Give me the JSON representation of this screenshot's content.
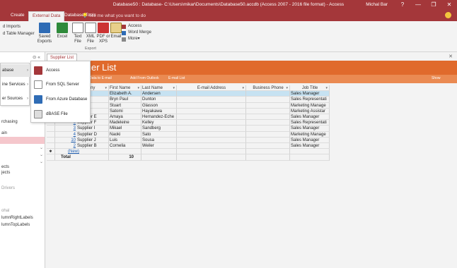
{
  "window": {
    "title": "Database50 : Database- C:\\Users\\mikar\\Documents\\Database50.accdb (Access 2007 - 2016 file format) - Access",
    "user": "Michal Bar",
    "controls": [
      "?",
      "—",
      "❐",
      "✕"
    ]
  },
  "ribbon_tabs": [
    "Create",
    "External Data",
    "Database Tools"
  ],
  "tell_me": "Tell me what you want to do",
  "ribbon": {
    "left_partial": [
      "d Imports",
      "d Table Manager"
    ],
    "buttons": [
      {
        "label": "Saved Exports",
        "icon": "saved-exports-icon"
      },
      {
        "label": "Excel",
        "icon": "excel-icon"
      },
      {
        "label": "Text File",
        "icon": "text-file-icon"
      },
      {
        "label": "XML File",
        "icon": "xml-file-icon"
      },
      {
        "label": "PDF or XPS",
        "icon": "pdf-icon"
      },
      {
        "label": "Email",
        "icon": "email-icon"
      }
    ],
    "small": [
      "Access",
      "Word Merge",
      "More"
    ],
    "group_label": "Export"
  },
  "nav": {
    "items": [
      "rchasing",
      "ain",
      "ects",
      "jects",
      "Drivers",
      "ohal",
      "lumnRightLabels",
      "lumnTopLabels"
    ]
  },
  "menu_left": [
    {
      "label": "abase",
      "arrow": "›"
    },
    {
      "label": "ine Services",
      "arrow": "›"
    },
    {
      "label": "er Sources",
      "arrow": "›"
    }
  ],
  "menu_right": [
    {
      "label": "Access",
      "icon": "access-icon"
    },
    {
      "label": "From SQL Server",
      "icon": "sql-server-icon"
    },
    {
      "label": "From Azure Database",
      "icon": "azure-database-icon"
    },
    {
      "label": "dBASE File",
      "icon": "dbase-icon"
    }
  ],
  "document": {
    "tab": "Supplier List",
    "banner_title": "plier List",
    "toolbar": [
      "ect Data to E-mail",
      "Add From Outlook",
      "E-mail List",
      "Show"
    ]
  },
  "grid": {
    "headers": [
      "ny",
      "First Name",
      "Last Name",
      "E-mail Address",
      "Business Phone",
      "Job Title"
    ],
    "rows": [
      {
        "num": "",
        "company": "",
        "first": "Elizabeth A.",
        "last": "Andersen",
        "title": "Sales Manager",
        "selected": true
      },
      {
        "num": "",
        "company": "",
        "first": "Bryn Paul",
        "last": "Dunton",
        "title": "Sales Representati"
      },
      {
        "num": "",
        "company": "",
        "first": "Stuart",
        "last": "Glasson",
        "title": "Marketing Manage"
      },
      {
        "num": "",
        "company": "",
        "first": "Satomi",
        "last": "Hayakawa",
        "title": "Marketing Assistar"
      },
      {
        "num": "5",
        "company": "Supplier E",
        "first": "Amaya",
        "last": "Hernandez-Eche",
        "title": "Sales Manager"
      },
      {
        "num": "6",
        "company": "Supplier F",
        "first": "Madeleine",
        "last": "Kelley",
        "title": "Sales Representati"
      },
      {
        "num": "3",
        "company": "Supplier I",
        "first": "Mikael",
        "last": "Sandberg",
        "title": "Sales Manager"
      },
      {
        "num": "4",
        "company": "Supplier D",
        "first": "Naoki",
        "last": "Sato",
        "title": "Marketing Manage"
      },
      {
        "num": "10",
        "company": "Supplier J",
        "first": "Luis",
        "last": "Sousa",
        "title": "Sales Manager"
      },
      {
        "num": "2",
        "company": "Supplier B",
        "first": "Cornelia",
        "last": "Weiler",
        "title": "Sales Manager"
      }
    ],
    "new_row": "(New)",
    "total_label": "Total",
    "total_value": "10"
  },
  "colors": {
    "access_red": "#a4373a",
    "banner_orange": "#e06a2c",
    "selected_row": "#c6e2f2"
  }
}
